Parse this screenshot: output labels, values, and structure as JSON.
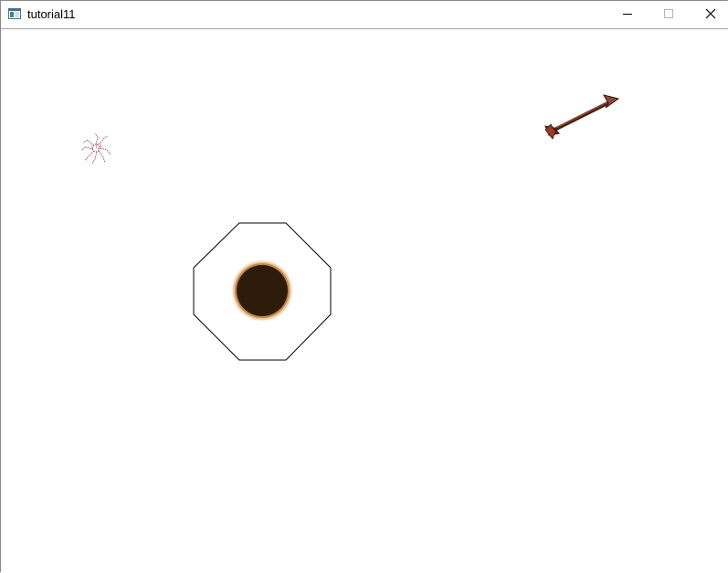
{
  "window": {
    "title": "tutorial11"
  },
  "controls": {
    "minimize_icon": "minimize-icon",
    "maximize_icon": "maximize-icon",
    "close_icon": "close-icon"
  },
  "scene": {
    "sprites": [
      "spider",
      "arrow",
      "octagon-boundary",
      "ball"
    ],
    "colors": {
      "ball_fill": "#2e1c0a",
      "ball_rim": "#c88842",
      "arrow_shaft": "#6b2a14",
      "arrow_head": "#7a3c28",
      "spider": "#a04058",
      "octagon_stroke": "#000000"
    }
  }
}
